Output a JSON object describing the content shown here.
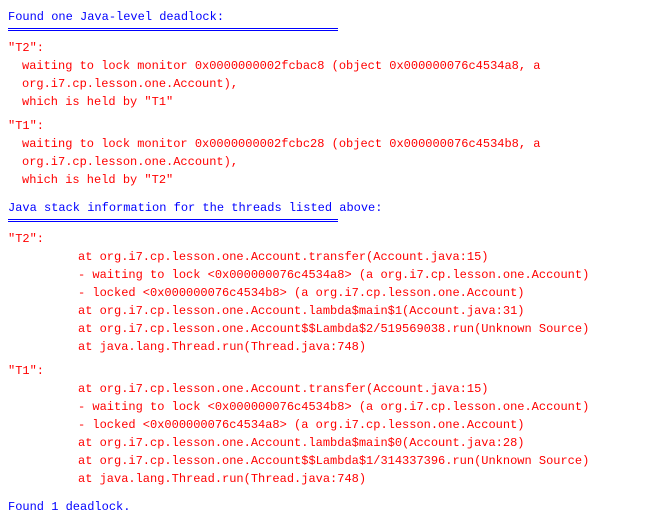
{
  "header": {
    "title": "Found one Java-level deadlock:"
  },
  "deadlock": {
    "threads": [
      {
        "name": "\"T2\":",
        "waiting": "waiting to lock monitor 0x0000000002fcbac8 (object 0x000000076c4534a8, a org.i7.cp.lesson.one.Account),",
        "heldBy": "which is held by \"T1\""
      },
      {
        "name": "\"T1\":",
        "waiting": "waiting to lock monitor 0x0000000002fcbc28 (object 0x000000076c4534b8, a org.i7.cp.lesson.one.Account),",
        "heldBy": "which is held by \"T2\""
      }
    ]
  },
  "stackHeader": "Java stack information for the threads listed above:",
  "stacks": [
    {
      "name": "\"T2\":",
      "lines": [
        "at org.i7.cp.lesson.one.Account.transfer(Account.java:15)",
        "- waiting to lock <0x000000076c4534a8> (a org.i7.cp.lesson.one.Account)",
        "- locked <0x000000076c4534b8> (a org.i7.cp.lesson.one.Account)",
        "at org.i7.cp.lesson.one.Account.lambda$main$1(Account.java:31)",
        "at org.i7.cp.lesson.one.Account$$Lambda$2/519569038.run(Unknown Source)",
        "at java.lang.Thread.run(Thread.java:748)"
      ]
    },
    {
      "name": "\"T1\":",
      "lines": [
        "at org.i7.cp.lesson.one.Account.transfer(Account.java:15)",
        "- waiting to lock <0x000000076c4534b8> (a org.i7.cp.lesson.one.Account)",
        "- locked <0x000000076c4534a8> (a org.i7.cp.lesson.one.Account)",
        "at org.i7.cp.lesson.one.Account.lambda$main$0(Account.java:28)",
        "at org.i7.cp.lesson.one.Account$$Lambda$1/314337396.run(Unknown Source)",
        "at java.lang.Thread.run(Thread.java:748)"
      ]
    }
  ],
  "footer": "Found 1 deadlock."
}
